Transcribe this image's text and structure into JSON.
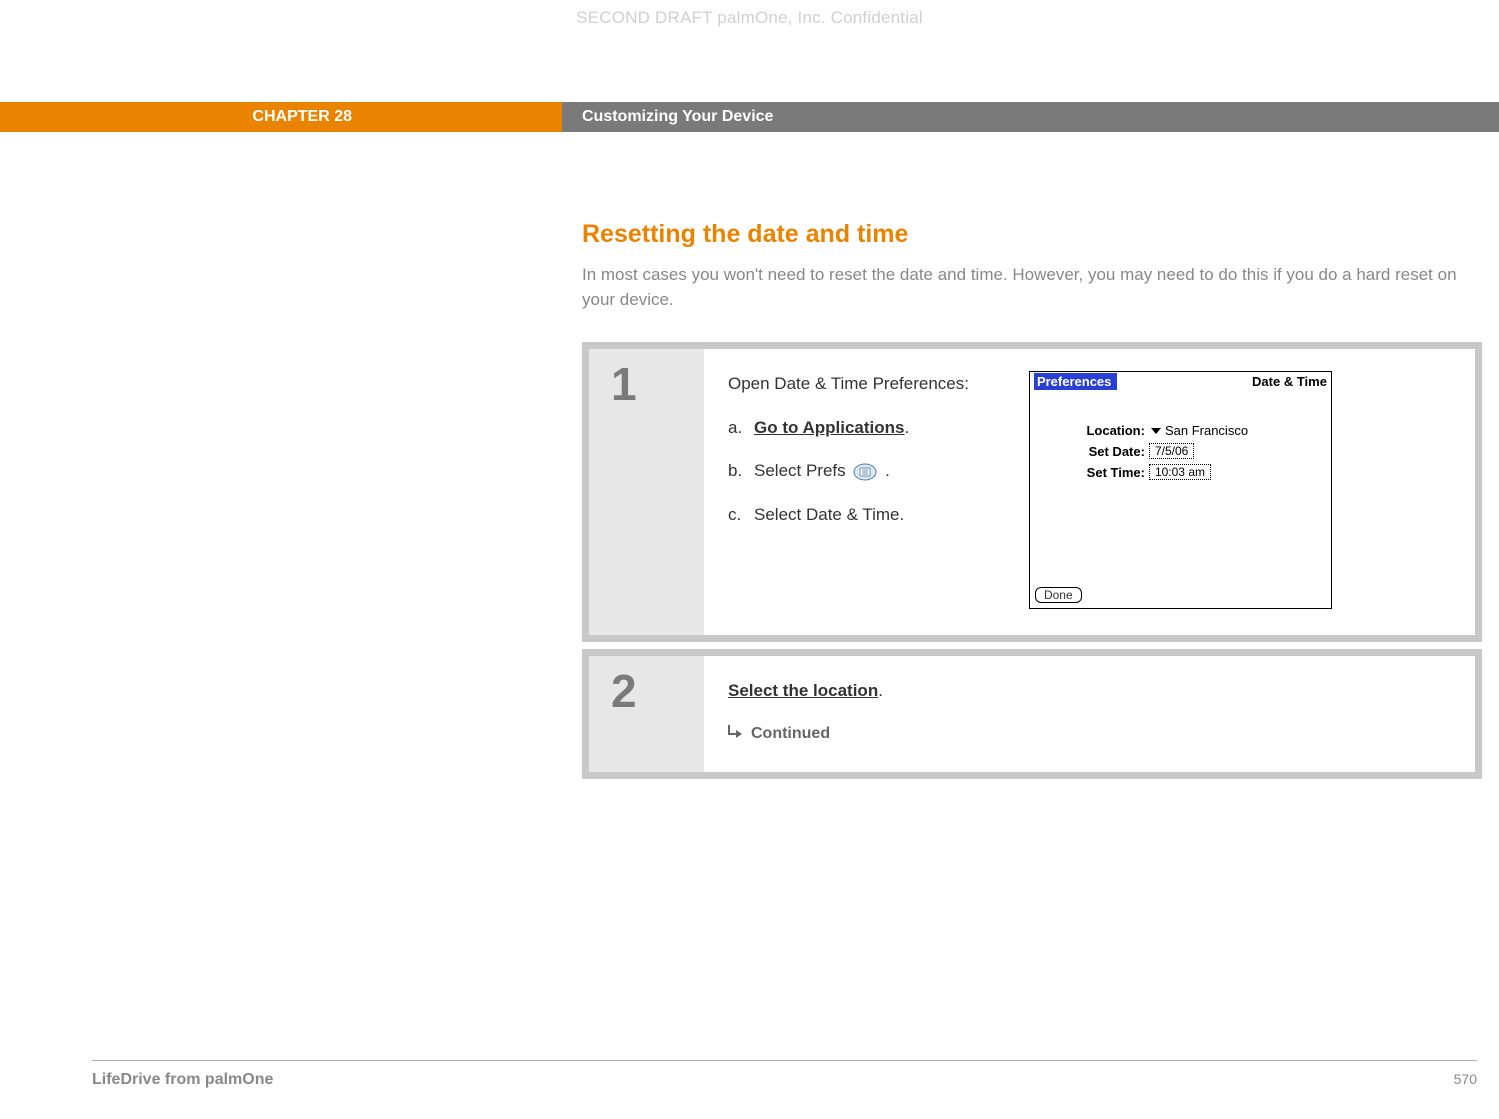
{
  "watermark": "SECOND DRAFT palmOne, Inc.  Confidential",
  "header": {
    "chapter": "CHAPTER 28",
    "title": "Customizing Your Device"
  },
  "section": {
    "title": "Resetting the date and time",
    "intro": "In most cases you won't need to reset the date and time. However, you may need to do this if you do a hard reset on your device."
  },
  "steps": [
    {
      "num": "1",
      "lead": "Open Date & Time Preferences:",
      "sub": [
        {
          "marker": "a.",
          "text_bold": "Go to Applications",
          "text_rest": "."
        },
        {
          "marker": "b.",
          "text_plain_pre": "Select Prefs ",
          "icon": "prefs-icon",
          "text_plain_post": "."
        },
        {
          "marker": "c.",
          "text_plain_pre": "Select Date & Time.",
          "text_plain_post": ""
        }
      ],
      "palm": {
        "title_left": "Preferences",
        "title_right": "Date & Time",
        "rows": [
          {
            "label": "Location:",
            "kind": "dropdown",
            "value": "San Francisco"
          },
          {
            "label": "Set Date:",
            "kind": "box",
            "value": "7/5/06"
          },
          {
            "label": "Set Time:",
            "kind": "box",
            "value": "10:03 am"
          }
        ],
        "done": "Done"
      }
    },
    {
      "num": "2",
      "link_text": "Select the location",
      "link_rest": ".",
      "continued": "Continued"
    }
  ],
  "footer": {
    "product": "LifeDrive from palmOne",
    "page": "570"
  }
}
